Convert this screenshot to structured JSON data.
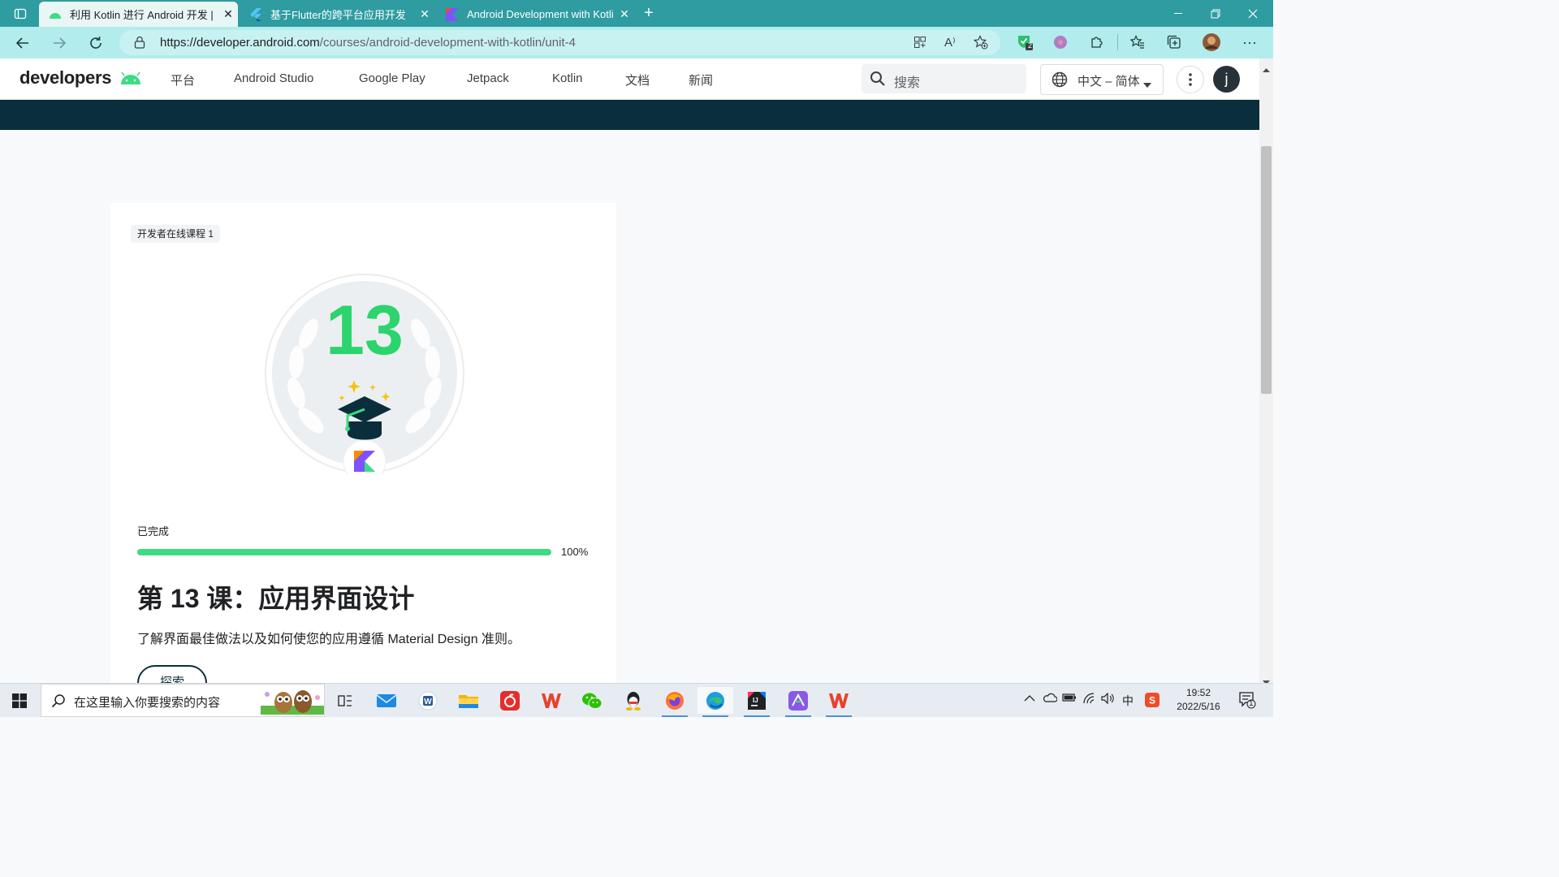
{
  "browser": {
    "tabs": [
      {
        "title": "利用 Kotlin 进行 Android 开发 |",
        "active": true,
        "icon": "android-icon"
      },
      {
        "title": "基于Flutter的跨平台应用开发",
        "active": false,
        "icon": "flutter-icon"
      },
      {
        "title": "Android Development with Kotli",
        "active": false,
        "icon": "kotlin-icon"
      }
    ],
    "new_tab_label": "+",
    "url_host": "https://developer.android.com",
    "url_path": "/courses/android-development-with-kotlin/unit-4",
    "extension_badge": "2"
  },
  "site": {
    "logo_text": "developers",
    "nav": [
      "平台",
      "Android Studio",
      "Google Play",
      "Jetpack",
      "Kotlin",
      "文档",
      "新闻"
    ],
    "search_placeholder": "搜索",
    "language": "中文 – 简体",
    "avatar_letter": "j"
  },
  "card": {
    "chip": "开发者在线课程 1",
    "badge_number": "13",
    "progress_label": "已完成",
    "progress_percent": 100,
    "progress_text": "100%",
    "title": "第 13 课：应用界面设计",
    "description": "了解界面最佳做法以及如何使您的应用遵循 Material Design 准则。",
    "button": "探索"
  },
  "taskbar": {
    "search_placeholder": "在这里输入你要搜索的内容",
    "time": "19:52",
    "date": "2022/5/16",
    "ime": "中",
    "notifications": "1"
  },
  "colors": {
    "tab_bar": "#2e9ca0",
    "address_bar": "#b2ecec",
    "android_green": "#3ddc84",
    "dark_band": "#0b2e3d"
  }
}
